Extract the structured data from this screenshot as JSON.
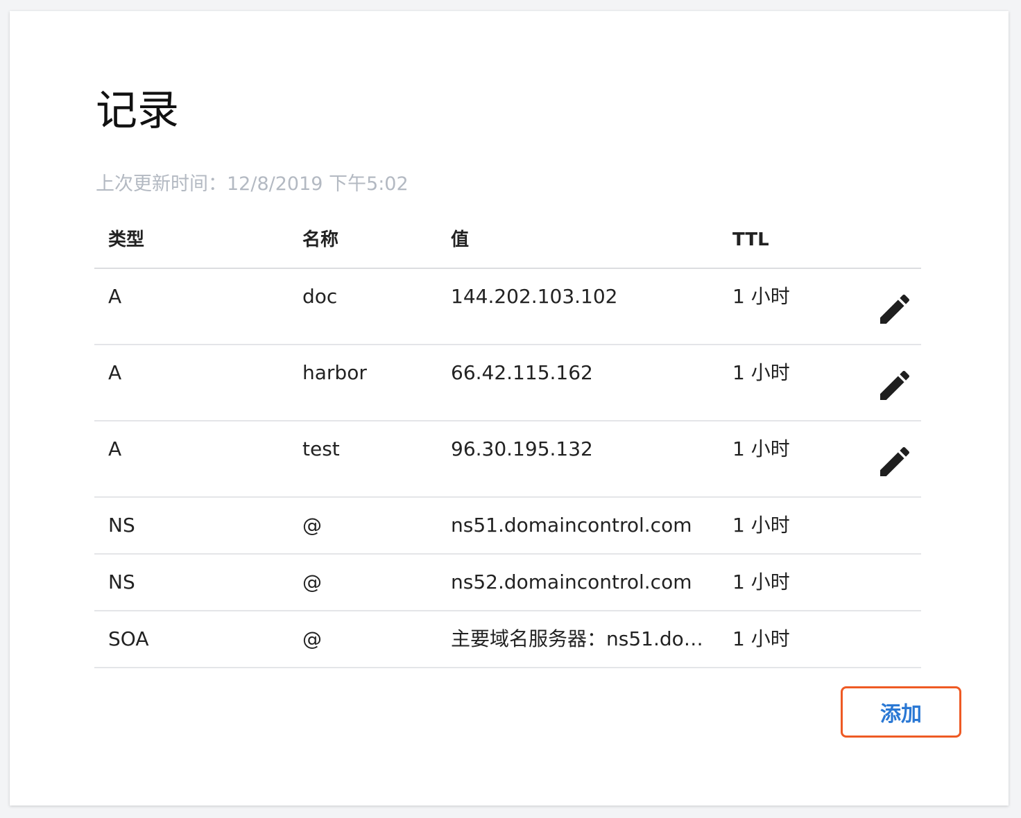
{
  "page": {
    "title": "记录",
    "last_updated": "上次更新时间：12/8/2019 下午5:02"
  },
  "table": {
    "headers": {
      "type": "类型",
      "name": "名称",
      "value": "值",
      "ttl": "TTL"
    },
    "rows": [
      {
        "type": "A",
        "name": "doc",
        "value": "144.202.103.102",
        "ttl": "1 小时",
        "editable": true
      },
      {
        "type": "A",
        "name": "harbor",
        "value": "66.42.115.162",
        "ttl": "1 小时",
        "editable": true
      },
      {
        "type": "A",
        "name": "test",
        "value": "96.30.195.132",
        "ttl": "1 小时",
        "editable": true
      },
      {
        "type": "NS",
        "name": "@",
        "value": "ns51.domaincontrol.com",
        "ttl": "1 小时",
        "editable": false
      },
      {
        "type": "NS",
        "name": "@",
        "value": "ns52.domaincontrol.com",
        "ttl": "1 小时",
        "editable": false
      },
      {
        "type": "SOA",
        "name": "@",
        "value": "主要域名服务器：ns51.do…",
        "ttl": "1 小时",
        "editable": false
      }
    ]
  },
  "actions": {
    "add_label": "添加"
  },
  "colors": {
    "add_border": "#ee5a24",
    "add_text": "#2a78d4",
    "muted_text": "#b3b9c2",
    "edit_icon": "#1f1f1f"
  }
}
